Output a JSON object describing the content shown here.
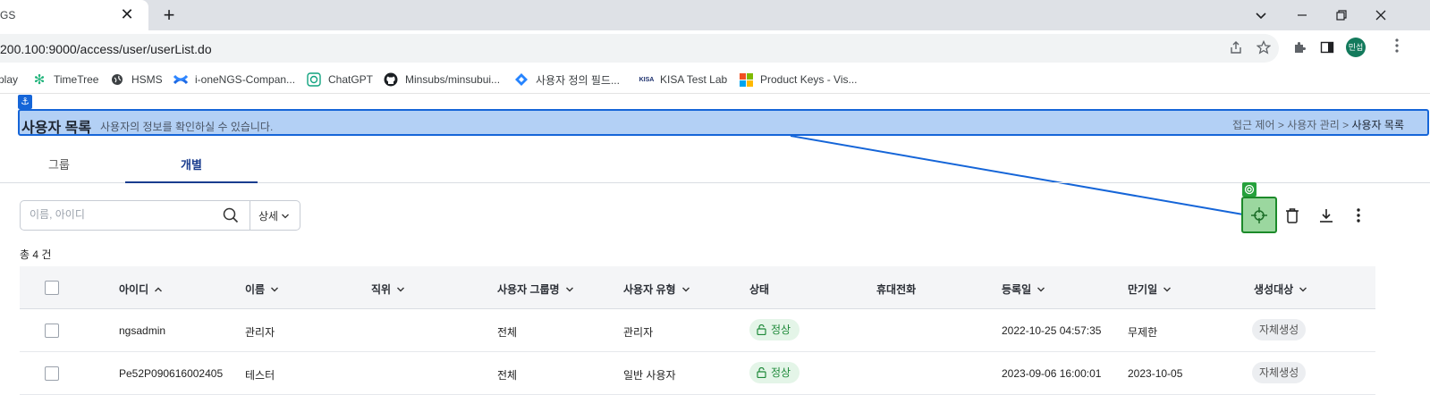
{
  "browser": {
    "tab_title": "GS",
    "url": "200.100:9000/access/user/userList.do",
    "profile_label": "민섭",
    "bookmarks": [
      {
        "label": "play"
      },
      {
        "label": "TimeTree"
      },
      {
        "label": "HSMS"
      },
      {
        "label": "i-oneNGS-Compan..."
      },
      {
        "label": "ChatGPT"
      },
      {
        "label": "Minsubs/minsubui..."
      },
      {
        "label": "사용자 정의 필드..."
      },
      {
        "label": "KISA Test Lab",
        "icon_text": "KISA"
      },
      {
        "label": "Product Keys - Vis..."
      }
    ]
  },
  "header": {
    "title": "사용자 목록",
    "subtitle": "사용자의 정보를 확인하실 수 있습니다.",
    "breadcrumb": {
      "item1": "접근 제어",
      "sep": ">",
      "item2": "사용자 관리",
      "current": "사용자 목록"
    }
  },
  "tabs": [
    {
      "label": "그룹",
      "active": false
    },
    {
      "label": "개별",
      "active": true
    }
  ],
  "search": {
    "placeholder": "이름, 아이디",
    "value": "",
    "detail_label": "상세"
  },
  "total_label": "총 4 건",
  "table": {
    "columns": [
      "아이디",
      "이름",
      "직위",
      "사용자 그룹명",
      "사용자 유형",
      "상태",
      "휴대전화",
      "등록일",
      "만기일",
      "생성대상"
    ],
    "rows": [
      {
        "id": "ngsadmin",
        "name": "관리자",
        "position": "",
        "group": "전체",
        "type": "관리자",
        "status": "정상",
        "phone": "",
        "registered": "2022-10-25 04:57:35",
        "expires": "무제한",
        "origin": "자체생성"
      },
      {
        "id": "Pe52P090616002405",
        "name": "테스터",
        "position": "",
        "group": "전체",
        "type": "일반 사용자",
        "status": "정상",
        "phone": "",
        "registered": "2023-09-06 16:00:01",
        "expires": "2023-10-05",
        "origin": "자체생성"
      }
    ]
  },
  "colors": {
    "accent": "#1565d8",
    "highlight": "#b3d0f5",
    "target_green": "#1c8a2a",
    "status_green": "#1f8a3a"
  }
}
